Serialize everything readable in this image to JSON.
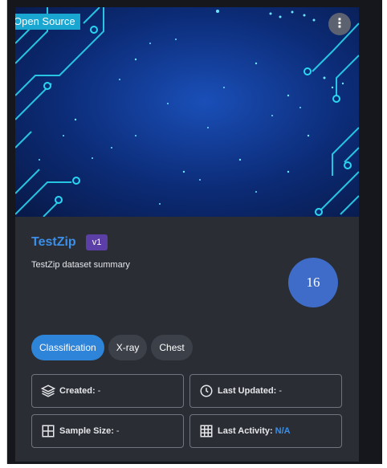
{
  "card": {
    "badge": "Open Source",
    "menu_icon": "more-vertical-icon",
    "title": "TestZip",
    "version": "v1",
    "summary": "TestZip dataset summary",
    "count": "16",
    "tags": [
      "Classification",
      "X-ray",
      "Chest"
    ],
    "info": {
      "created_label": "Created:",
      "created_value": "-",
      "updated_label": "Last Updated:",
      "updated_value": "-",
      "sample_label": "Sample Size:",
      "sample_value": "-",
      "activity_label": "Last Activity:",
      "activity_value": "N/A"
    }
  },
  "colors": {
    "accent": "#3b8fe8",
    "badge_bg": "#19a6d1",
    "version_bg": "#5b3ea6",
    "count_bg": "#3f6cc8",
    "tag_primary": "#2d84d8",
    "card_bg": "#2a2d34"
  },
  "icons": {
    "created": "layers-icon",
    "updated": "clock-icon",
    "sample": "table-icon",
    "activity": "grid-icon"
  }
}
